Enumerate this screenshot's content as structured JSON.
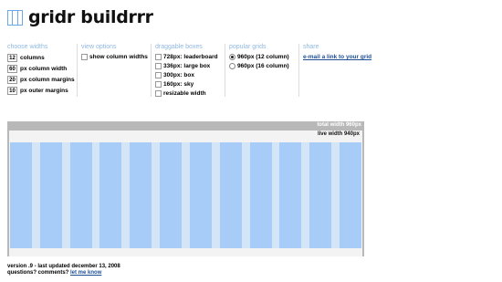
{
  "app": {
    "title": "gridr buildrrr"
  },
  "panels": {
    "choose_widths": {
      "title": "choose widths",
      "fields": [
        {
          "value": "12",
          "label": "columns"
        },
        {
          "value": "60",
          "label": "px column width"
        },
        {
          "value": "20",
          "label": "px column margins"
        },
        {
          "value": "10",
          "label": "px outer margins"
        }
      ]
    },
    "view_options": {
      "title": "view options",
      "checkbox_label": "show column widths",
      "checked": false
    },
    "draggable_boxes": {
      "title": "draggable boxes",
      "items": [
        "728px: leaderboard",
        "336px: large box",
        "300px: box",
        "160px: sky",
        "resizable width"
      ]
    },
    "popular_grids": {
      "title": "popular grids",
      "options": [
        {
          "label": "960px (12 column)",
          "selected": true
        },
        {
          "label": "960px (16 column)",
          "selected": false
        }
      ]
    },
    "share": {
      "title": "share",
      "link_text": "e-mail a link to your grid"
    }
  },
  "grid": {
    "total_width_label": "total width 960px",
    "live_width_label": "live width 940px",
    "column_count": 12,
    "column_color": "#a6ccf7",
    "gutter_color": "#d3e5f7"
  },
  "footer": {
    "version_text": "version .9 - last updated december 13, 2008",
    "question_text": "questions? comments?",
    "contact_link": "let me know"
  }
}
